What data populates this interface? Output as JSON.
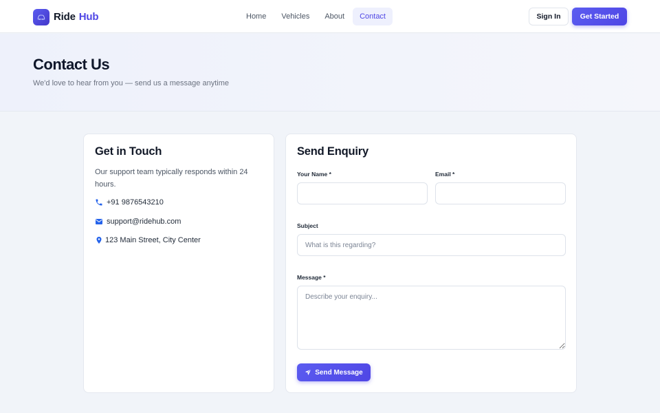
{
  "brand": {
    "name_part1": "Ride",
    "name_part2": "Hub"
  },
  "nav": {
    "links": [
      {
        "label": "Home"
      },
      {
        "label": "Vehicles"
      },
      {
        "label": "About"
      },
      {
        "label": "Contact",
        "active": true
      }
    ],
    "sign_in_label": "Sign In",
    "get_started_label": "Get Started"
  },
  "hero": {
    "title": "Contact Us",
    "subtitle": "We'd love to hear from you — send us a message anytime"
  },
  "info_card": {
    "title": "Get in Touch",
    "description": "Our support team typically responds within 24 hours.",
    "phone": "+91 9876543210",
    "email": "support@ridehub.com",
    "address": "123 Main Street, City Center",
    "icons": {
      "phone": "phone-icon",
      "email": "envelope-icon",
      "address": "map-pin-icon"
    }
  },
  "form": {
    "title": "Send Enquiry",
    "name_label": "Your Name *",
    "name_value": "",
    "email_label": "Email *",
    "email_value": "",
    "subject_label": "Subject",
    "subject_placeholder": "What is this regarding?",
    "message_label": "Message *",
    "message_placeholder": "Describe your enquiry...",
    "submit_label": "Send Message",
    "submit_icon": "paper-plane-icon"
  },
  "colors": {
    "accent": "#4f46e5",
    "icon_blue": "#2563eb",
    "page_bg": "#f1f4f9"
  }
}
